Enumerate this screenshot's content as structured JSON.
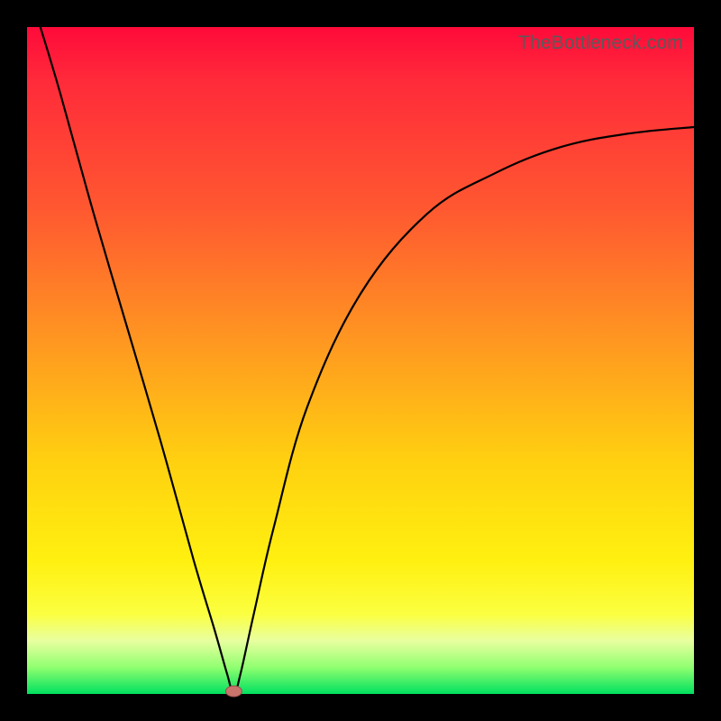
{
  "watermark": "TheBottleneck.com",
  "chart_data": {
    "type": "line",
    "title": "",
    "xlabel": "",
    "ylabel": "",
    "xlim": [
      0,
      1
    ],
    "ylim": [
      0,
      1
    ],
    "min_point": {
      "x": 0.31,
      "y": 0.0
    },
    "gradient_stops": [
      {
        "pos": 0.0,
        "color": "#ff0a3a"
      },
      {
        "pos": 0.28,
        "color": "#ff5a30"
      },
      {
        "pos": 0.65,
        "color": "#ffd010"
      },
      {
        "pos": 0.88,
        "color": "#fbff40"
      },
      {
        "pos": 1.0,
        "color": "#00e060"
      }
    ],
    "series": [
      {
        "name": "bottleneck-curve",
        "x": [
          0.02,
          0.05,
          0.1,
          0.15,
          0.2,
          0.25,
          0.28,
          0.3,
          0.31,
          0.32,
          0.34,
          0.37,
          0.42,
          0.5,
          0.6,
          0.7,
          0.8,
          0.9,
          1.0
        ],
        "y": [
          1.0,
          0.9,
          0.72,
          0.55,
          0.38,
          0.2,
          0.1,
          0.03,
          0.0,
          0.03,
          0.12,
          0.25,
          0.43,
          0.6,
          0.72,
          0.78,
          0.82,
          0.84,
          0.85
        ]
      }
    ]
  }
}
